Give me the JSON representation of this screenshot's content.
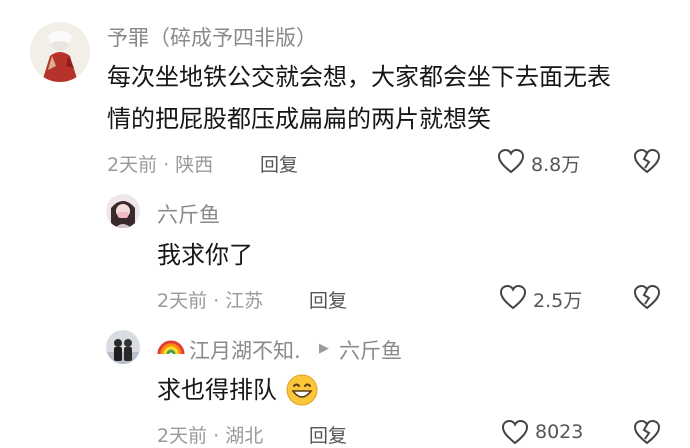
{
  "comments": [
    {
      "username": "予罪（碎成予四非版）",
      "text_lines": [
        "每次坐地铁公交就会想，大家都会坐下去面无表",
        "情的把屁股都压成扁扁的两片就想笑"
      ],
      "meta": "2天前 · 陕西",
      "reply_label": "回复",
      "likes": "8.8万"
    },
    {
      "username": "六斤鱼",
      "text": "我求你了",
      "meta": "2天前 · 江苏",
      "reply_label": "回复",
      "likes": "2.5万"
    },
    {
      "username": "江月湖不知.",
      "reply_to": "六斤鱼",
      "text": "求也得排队",
      "meta": "2天前 · 湖北",
      "reply_label": "回复",
      "likes": "8023"
    }
  ]
}
